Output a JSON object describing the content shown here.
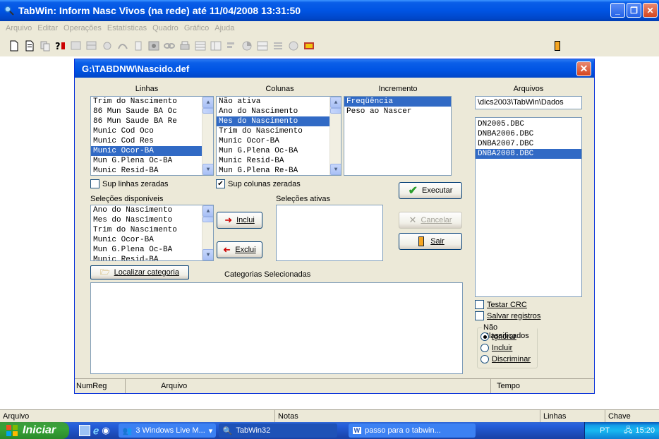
{
  "app": {
    "title": "TabWin: Inform Nasc Vivos (na rede) até 11/04/2008 13:31:50",
    "menu": [
      "Arquivo",
      "Editar",
      "Operações",
      "Estatísticas",
      "Quadro",
      "Gráfico",
      "Ajuda"
    ]
  },
  "dialog": {
    "title": "G:\\TABDNW\\Nascido.def",
    "linhas": {
      "header": "Linhas",
      "items": [
        "Trim do Nascimento",
        "86 Mun Saude BA Oc",
        "86 Mun Saude BA Re",
        "Munic Cod Oco",
        "Munic Cod Res",
        "Munic Ocor-BA",
        "Mun G.Plena Oc-BA",
        "Munic Resid-BA"
      ],
      "selected_index": 5
    },
    "colunas": {
      "header": "Colunas",
      "items": [
        "Não ativa",
        "Ano do Nascimento",
        "Mes do Nascimento",
        "Trim do Nascimento",
        "Munic Ocor-BA",
        "Mun G.Plena Oc-BA",
        "Munic Resid-BA",
        "Mun G.Plena Re-BA"
      ],
      "selected_index": 2
    },
    "incremento": {
      "header": "Incremento",
      "items": [
        "Freqüência",
        "Peso ao Nascer"
      ],
      "selected_index": 0
    },
    "arquivos": {
      "header": "Arquivos",
      "path": "\\dics2003\\TabWin\\Dados",
      "items": [
        "DN2005.DBC",
        "DNBA2006.DBC",
        "DNBA2007.DBC",
        "DNBA2008.DBC"
      ],
      "selected_index": 3
    },
    "sup_linhas": "Sup linhas zeradas",
    "sup_colunas": "Sup colunas zeradas",
    "sup_colunas_checked": "✔",
    "selecoes_disponiveis": {
      "header": "Seleções disponíveis",
      "items": [
        "Ano do Nascimento",
        "Mes do Nascimento",
        "Trim do Nascimento",
        "Munic Ocor-BA",
        "Mun G.Plena Oc-BA",
        "Munic Resid-BA"
      ]
    },
    "selecoes_ativas": "Seleções ativas",
    "inclui": "Inclui",
    "exclui": "Exclui",
    "localizar": "Localizar categoria",
    "categorias": "Categorias Selecionadas",
    "executar": "Executar",
    "cancelar": "Cancelar",
    "sair": "Sair",
    "testar_crc": "Testar CRC",
    "salvar_registros": "Salvar registros",
    "nao_classificados": {
      "title": "Não Classificados",
      "options": [
        "Ignorar",
        "Incluir",
        "Discriminar"
      ],
      "selected_index": 0
    },
    "status": {
      "numreg": "NumReg",
      "arquivo": "Arquivo",
      "tempo": "Tempo"
    }
  },
  "statusbar": {
    "arquivo": "Arquivo",
    "notas": "Notas",
    "linhas": "Linhas",
    "chave": "Chave"
  },
  "taskbar": {
    "start": "Iniciar",
    "tasks": [
      "3 Windows Live M...",
      "TabWin32",
      "passo para o tabwin..."
    ],
    "lang": "PT",
    "clock": "15:20"
  },
  "colors": {
    "selection": "#316ac5",
    "title_blue": "#0054e3",
    "close_red": "#d6451f"
  }
}
